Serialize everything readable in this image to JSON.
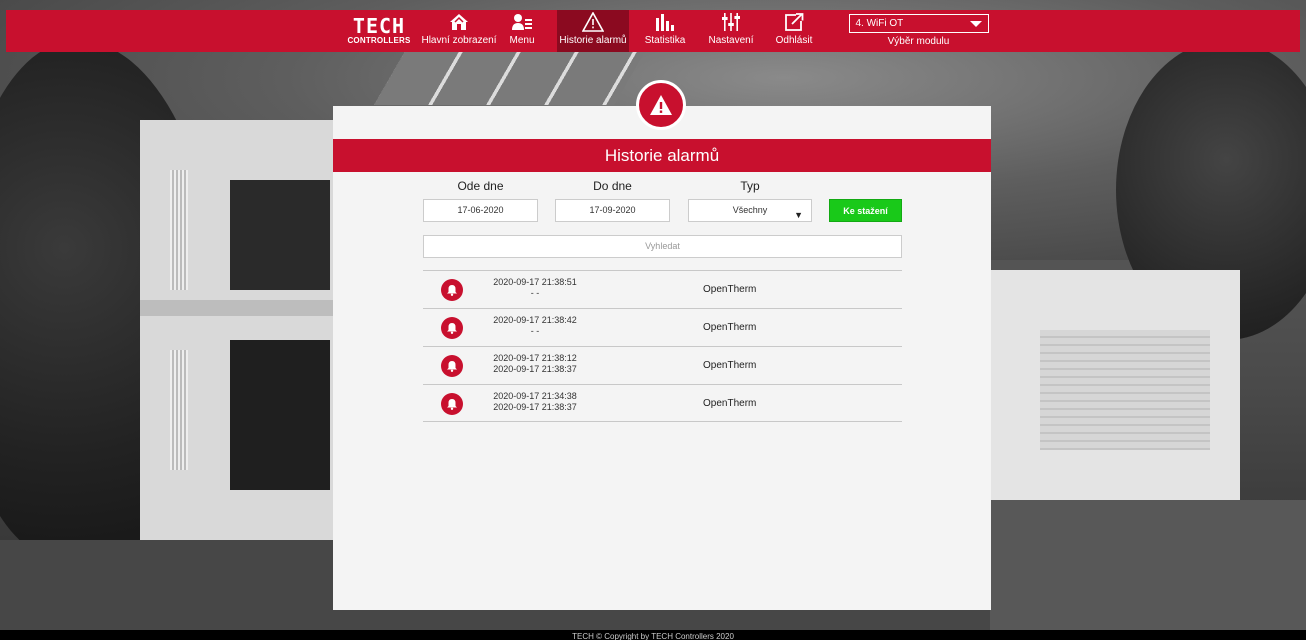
{
  "logo": {
    "brand": "TECH",
    "sub": "CONTROLLERS"
  },
  "nav": [
    {
      "label": "Hlavní zobrazení",
      "icon": "home-icon"
    },
    {
      "label": "Menu",
      "icon": "menu-user-icon"
    },
    {
      "label": "Historie alarmů",
      "icon": "warning-icon"
    },
    {
      "label": "Statistika",
      "icon": "bar-chart-icon"
    },
    {
      "label": "Nastavení",
      "icon": "sliders-icon"
    },
    {
      "label": "Odhlásit",
      "icon": "logout-icon"
    }
  ],
  "module": {
    "selected": "4. WiFi OT",
    "label": "Výběr modulu"
  },
  "panel": {
    "title": "Historie alarmů",
    "filters": {
      "from_label": "Ode dne",
      "from_value": "17-06-2020",
      "to_label": "Do dne",
      "to_value": "17-09-2020",
      "type_label": "Typ",
      "type_value": "Všechny",
      "download_label": "Ke stažení"
    },
    "search_placeholder": "Vyhledat",
    "alarms": [
      {
        "start": "2020-09-17 21:38:51",
        "end": "- -",
        "type": "OpenTherm"
      },
      {
        "start": "2020-09-17 21:38:42",
        "end": "- -",
        "type": "OpenTherm"
      },
      {
        "start": "2020-09-17 21:38:12",
        "end": "2020-09-17 21:38:37",
        "type": "OpenTherm"
      },
      {
        "start": "2020-09-17 21:34:38",
        "end": "2020-09-17 21:38:37",
        "type": "OpenTherm"
      }
    ]
  },
  "footer": {
    "text": "TECH © Copyright by TECH Controllers 2020"
  },
  "colors": {
    "brand_red": "#c8102e",
    "active_nav": "#8b0a20",
    "download_green": "#19c919"
  }
}
